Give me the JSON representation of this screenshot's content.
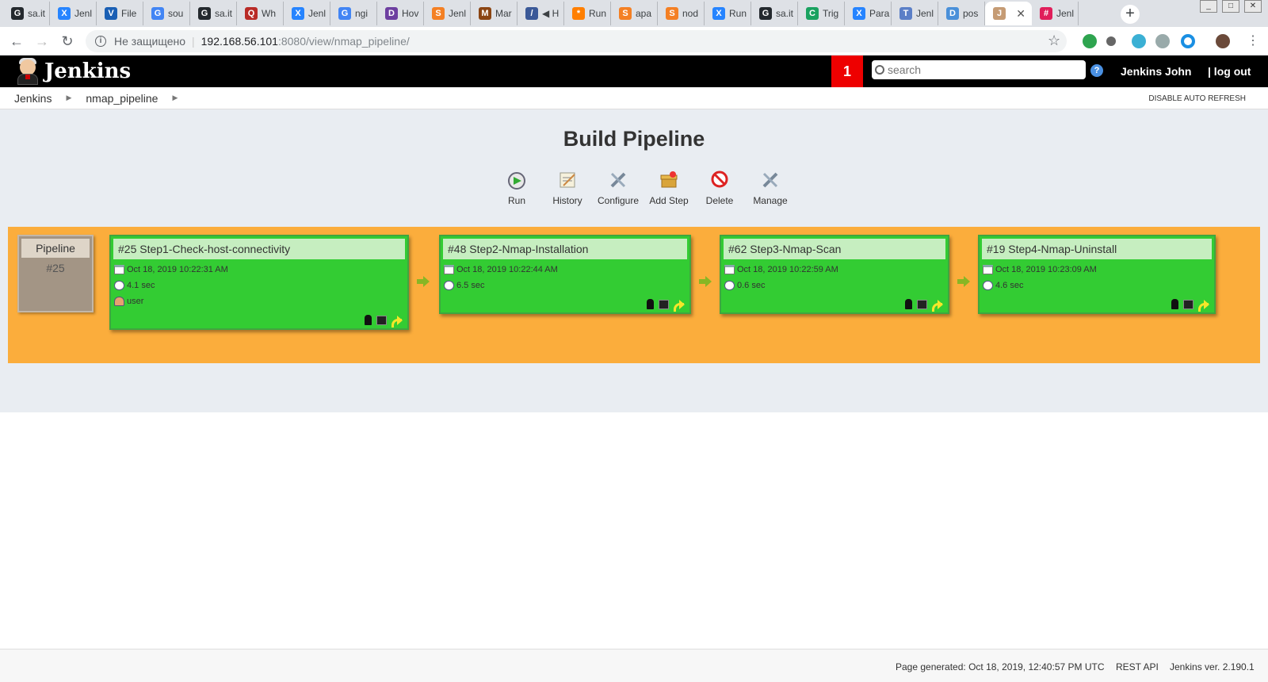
{
  "browser": {
    "tabs": [
      {
        "label": "sa.it",
        "color": "#24292e",
        "glyph": "G"
      },
      {
        "label": "Jenl",
        "color": "#2684ff",
        "glyph": "X"
      },
      {
        "label": "File",
        "color": "#1a5fb4",
        "glyph": "V"
      },
      {
        "label": "sou",
        "color": "#4285f4",
        "glyph": "G"
      },
      {
        "label": "sa.it",
        "color": "#24292e",
        "glyph": "G"
      },
      {
        "label": "Wh",
        "color": "#b92b27",
        "glyph": "Q"
      },
      {
        "label": "Jenl",
        "color": "#2684ff",
        "glyph": "X"
      },
      {
        "label": "ngi",
        "color": "#4285f4",
        "glyph": "G"
      },
      {
        "label": "Hov",
        "color": "#6d3fa0",
        "glyph": "D"
      },
      {
        "label": "Jenl",
        "color": "#f48024",
        "glyph": "S"
      },
      {
        "label": "Mar",
        "color": "#8b4513",
        "glyph": "M"
      },
      {
        "label": "◀ H",
        "color": "#3b5998",
        "glyph": "/"
      },
      {
        "label": "Run",
        "color": "#ff7f00",
        "glyph": "*"
      },
      {
        "label": "apa",
        "color": "#f48024",
        "glyph": "S"
      },
      {
        "label": "nod",
        "color": "#f48024",
        "glyph": "S"
      },
      {
        "label": "Run",
        "color": "#2684ff",
        "glyph": "X"
      },
      {
        "label": "sa.it",
        "color": "#24292e",
        "glyph": "G"
      },
      {
        "label": "Trig",
        "color": "#1aa260",
        "glyph": "C"
      },
      {
        "label": "Para",
        "color": "#2684ff",
        "glyph": "X"
      },
      {
        "label": "Jenl",
        "color": "#5b7fc7",
        "glyph": "T"
      },
      {
        "label": "pos",
        "color": "#4a90d9",
        "glyph": "D"
      },
      {
        "label": "",
        "color": "#c59b74",
        "glyph": "J"
      },
      {
        "label": "Jenl",
        "color": "#e01e5a",
        "glyph": "#"
      }
    ],
    "active_tab_close": "✕",
    "new_tab": "+",
    "security_text": "Не защищено",
    "url_host": "192.168.56.101",
    "url_path": ":8080/view/nmap_pipeline/"
  },
  "header": {
    "logo_text": "Jenkins",
    "notification_count": "1",
    "search_placeholder": "search",
    "help": "?",
    "user_name": "Jenkins John",
    "logout": "| log out"
  },
  "breadcrumb": {
    "items": [
      "Jenkins",
      "nmap_pipeline"
    ],
    "auto_refresh": "DISABLE AUTO REFRESH"
  },
  "main": {
    "title": "Build Pipeline",
    "toolbar": [
      {
        "label": "Run",
        "icon": "run-icon"
      },
      {
        "label": "History",
        "icon": "history-icon"
      },
      {
        "label": "Configure",
        "icon": "configure-icon"
      },
      {
        "label": "Add Step",
        "icon": "add-step-icon"
      },
      {
        "label": "Delete",
        "icon": "delete-icon"
      },
      {
        "label": "Manage",
        "icon": "manage-icon"
      }
    ],
    "pipeline": {
      "label": "Pipeline",
      "number": "#25"
    },
    "builds": [
      {
        "title": "#25 Step1-Check-host-connectivity",
        "date": "Oct 18, 2019 10:22:31 AM",
        "duration": "4.1 sec",
        "user": "user"
      },
      {
        "title": "#48 Step2-Nmap-Installation",
        "date": "Oct 18, 2019 10:22:44 AM",
        "duration": "6.5 sec",
        "user": null
      },
      {
        "title": "#62 Step3-Nmap-Scan",
        "date": "Oct 18, 2019 10:22:59 AM",
        "duration": "0.6 sec",
        "user": null
      },
      {
        "title": "#19 Step4-Nmap-Uninstall",
        "date": "Oct 18, 2019 10:23:09 AM",
        "duration": "4.6 sec",
        "user": null
      }
    ],
    "colors": {
      "success": "#33cc33",
      "board": "#fbad3c",
      "pipeline_box": "#a39585"
    }
  },
  "footer": {
    "generated": "Page generated: Oct 18, 2019, 12:40:57 PM UTC",
    "rest_api": "REST API",
    "version": "Jenkins ver. 2.190.1"
  }
}
